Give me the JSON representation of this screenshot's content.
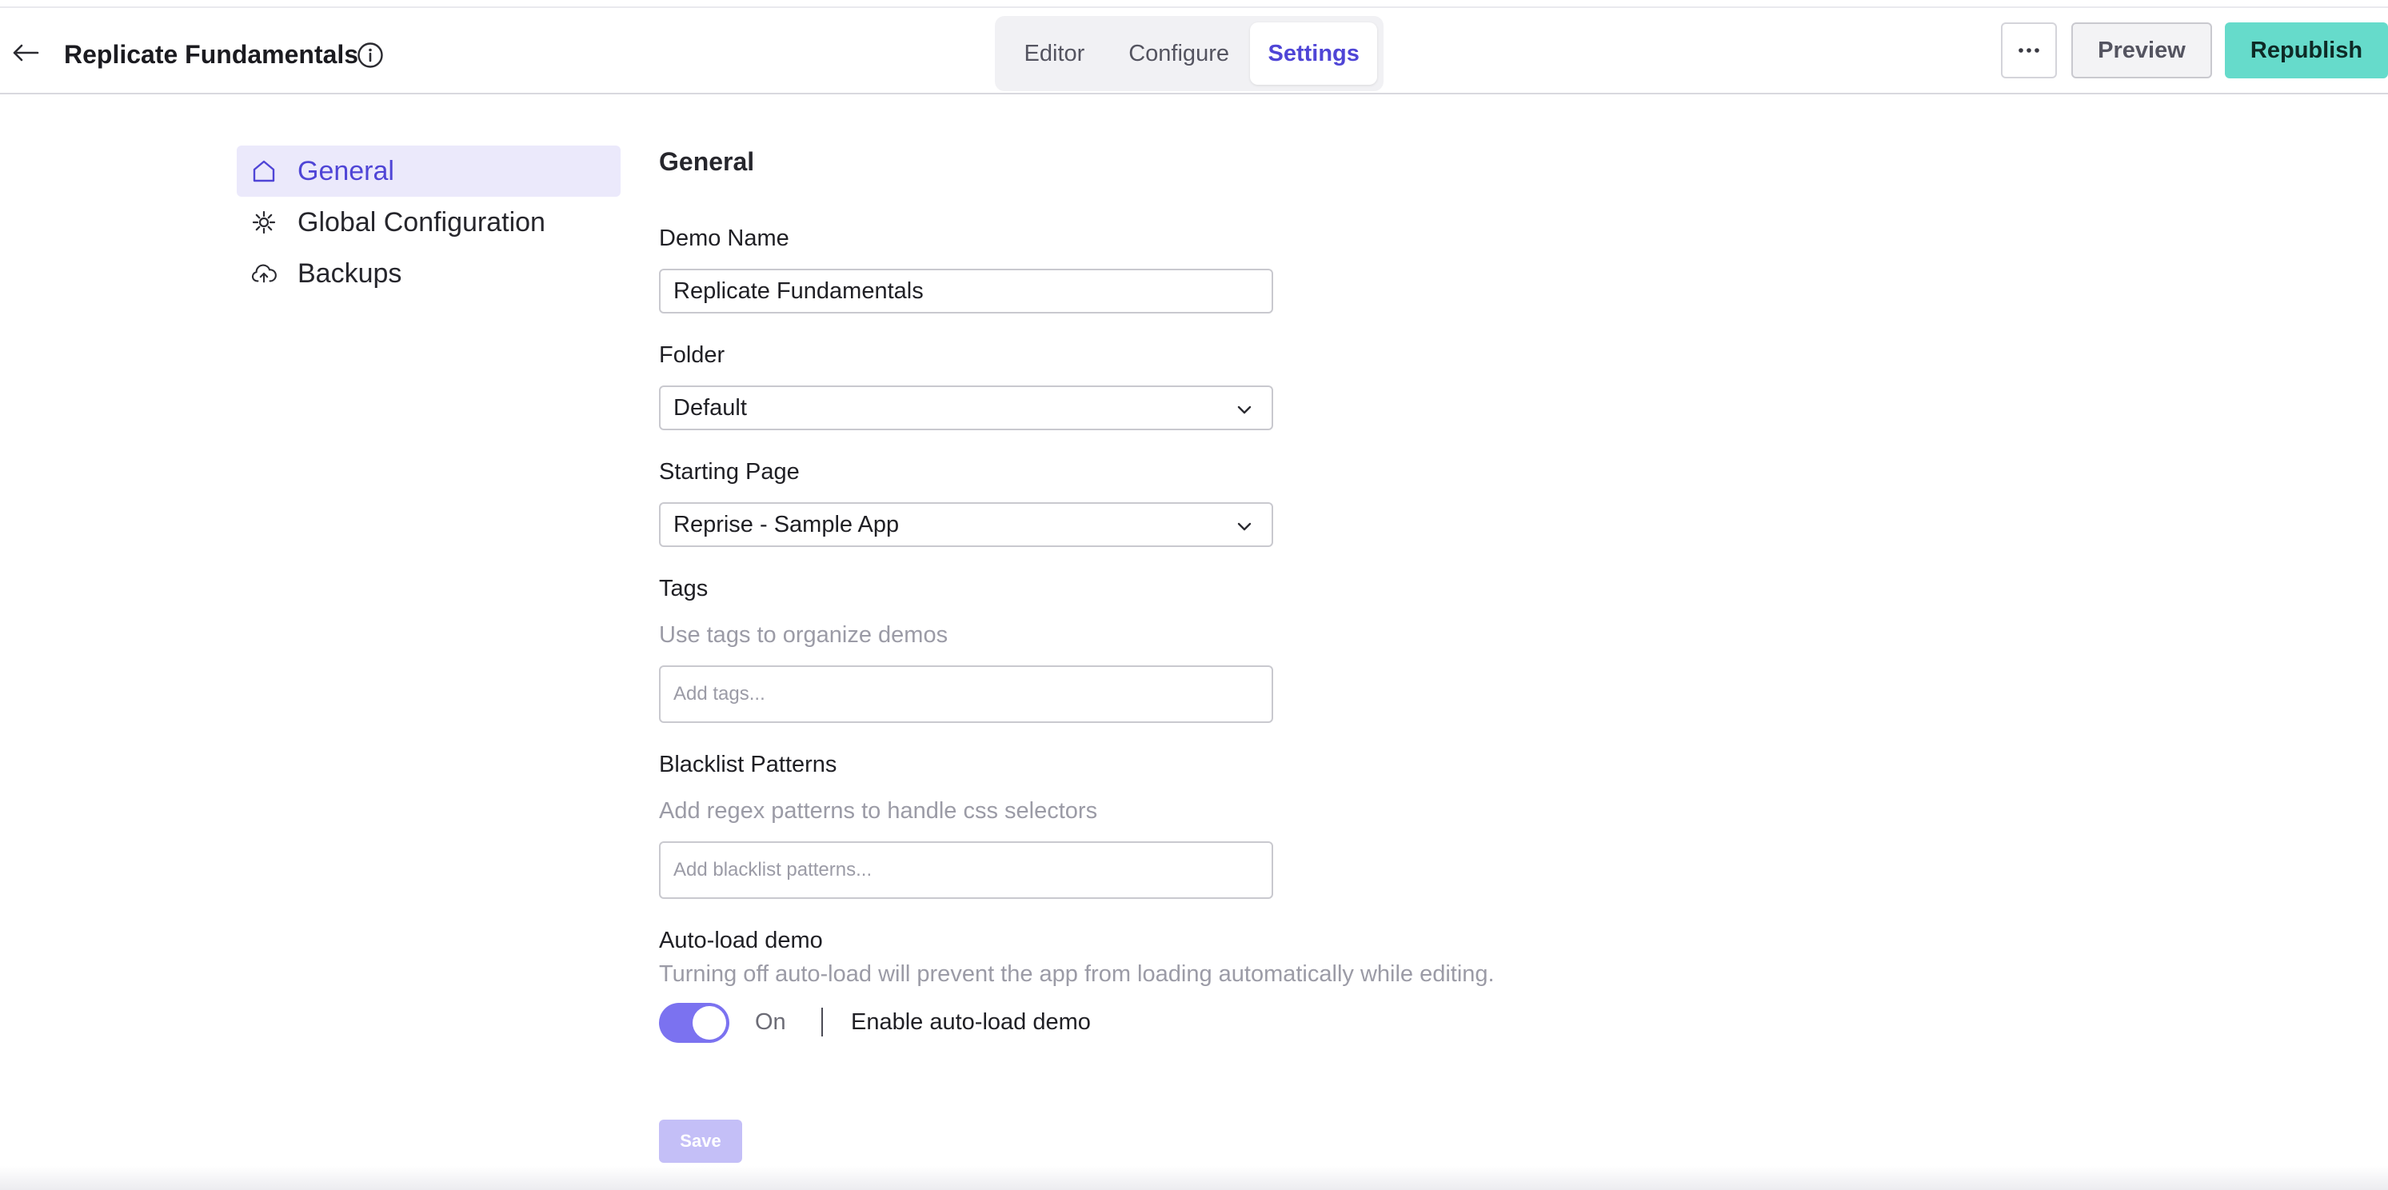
{
  "header": {
    "title": "Replicate Fundamentals",
    "tabs": [
      {
        "label": "Editor"
      },
      {
        "label": "Configure"
      },
      {
        "label": "Settings"
      }
    ],
    "active_tab": "Settings",
    "preview_label": "Preview",
    "republish_label": "Republish"
  },
  "sidebar": {
    "items": [
      {
        "label": "General",
        "icon": "home-icon",
        "active": true
      },
      {
        "label": "Global Configuration",
        "icon": "gear-icon",
        "active": false
      },
      {
        "label": "Backups",
        "icon": "cloud-upload-icon",
        "active": false
      }
    ]
  },
  "form": {
    "section_title": "General",
    "demo_name": {
      "label": "Demo Name",
      "value": "Replicate Fundamentals"
    },
    "folder": {
      "label": "Folder",
      "value": "Default"
    },
    "starting_page": {
      "label": "Starting Page",
      "value": "Reprise - Sample App"
    },
    "tags": {
      "label": "Tags",
      "help": "Use tags to organize demos",
      "placeholder": "Add tags..."
    },
    "blacklist": {
      "label": "Blacklist Patterns",
      "help": "Add regex patterns to handle css selectors",
      "placeholder": "Add blacklist patterns..."
    },
    "autoload": {
      "label": "Auto-load demo",
      "help": "Turning off auto-load will prevent the app from loading automatically while editing.",
      "state_label": "On",
      "toggle_label": "Enable auto-load demo",
      "enabled": true
    },
    "save_label": "Save"
  },
  "colors": {
    "accent": "#4f45d6",
    "toggle_on": "#7b72f0",
    "republish": "#66dbcb",
    "active_nav_bg": "#ebe9fb"
  }
}
